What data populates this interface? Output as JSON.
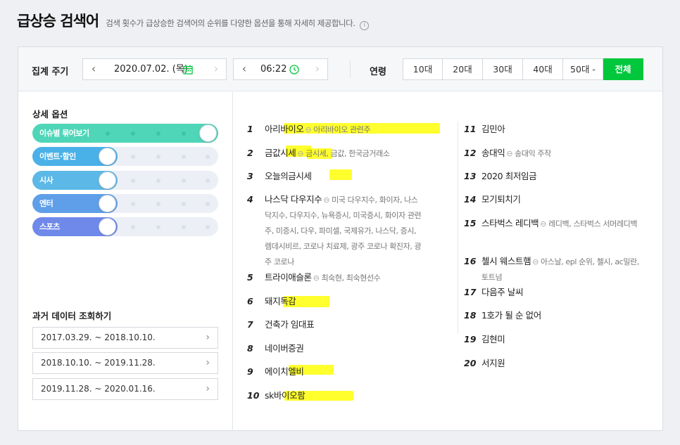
{
  "header": {
    "title": "급상승 검색어",
    "description": "검색 횟수가 급상승한 검색어의 순위를 다양한 옵션을 통해 자세히 제공합니다.",
    "info_icon": "i"
  },
  "filters": {
    "period_label": "집계 주기",
    "date": "2020.07.02. (목)",
    "time": "06:22",
    "prev_icon": "‹",
    "next_icon": "›",
    "age_label": "연령",
    "age_buttons": [
      "10대",
      "20대",
      "30대",
      "40대",
      "50대 -",
      "전체"
    ],
    "age_selected": "전체",
    "accent_color": "#00c73c"
  },
  "options": {
    "title": "상세 옵션",
    "toggles": [
      {
        "label": "이슈별 묶어보기",
        "on": true,
        "color": "#4fd6b8"
      },
      {
        "label": "이벤트·할인",
        "on": false,
        "color": "#4ab1e8"
      },
      {
        "label": "시사",
        "on": false,
        "color": "#5cb8e6"
      },
      {
        "label": "엔터",
        "on": false,
        "color": "#5f9ee8"
      },
      {
        "label": "스포츠",
        "on": false,
        "color": "#6f89ea"
      }
    ]
  },
  "history": {
    "title": "과거 데이터 조회하기",
    "periods": [
      "2017.03.29. ~ 2018.10.10.",
      "2018.10.10. ~ 2019.11.28.",
      "2019.11.28. ~ 2020.01.16."
    ],
    "chevron": "›"
  },
  "rankings": [
    {
      "rank": "1",
      "keyword": "아리바이오",
      "related": "아리바이오 관련주"
    },
    {
      "rank": "2",
      "keyword": "금값시세",
      "related": "금시세, 금값, 한국금거래소"
    },
    {
      "rank": "3",
      "keyword": "오늘의금시세",
      "related": ""
    },
    {
      "rank": "4",
      "keyword": "나스닥 다우지수",
      "related": "미국 다우지수, 화이자, 나스닥지수, 다우지수, 뉴욕증시, 미국증시, 화이자 관련주, 미증시, 다우, 파미셀, 국제유가, 나스닥, 증시, 렘데시비르, 코로나 치료제, 광주 코로나 확진자, 광주 코로나"
    },
    {
      "rank": "5",
      "keyword": "트라이애슬론",
      "related": "최숙현, 최숙현선수"
    },
    {
      "rank": "6",
      "keyword": "돼지독감",
      "related": ""
    },
    {
      "rank": "7",
      "keyword": "건축가 임대표",
      "related": ""
    },
    {
      "rank": "8",
      "keyword": "네이버증권",
      "related": ""
    },
    {
      "rank": "9",
      "keyword": "에이치엘비",
      "related": ""
    },
    {
      "rank": "10",
      "keyword": "sk바이오팜",
      "related": ""
    },
    {
      "rank": "11",
      "keyword": "김민아",
      "related": ""
    },
    {
      "rank": "12",
      "keyword": "송대익",
      "related": "송대익 주작"
    },
    {
      "rank": "13",
      "keyword": "2020 최저임금",
      "related": ""
    },
    {
      "rank": "14",
      "keyword": "모기퇴치기",
      "related": ""
    },
    {
      "rank": "15",
      "keyword": "스타벅스 레디백",
      "related": "레디백, 스타벅스 서머레디백"
    },
    {
      "rank": "16",
      "keyword": "첼시 웨스트햄",
      "related": "아스날, epl 순위, 첼시, ac밀란, 토트넘"
    },
    {
      "rank": "17",
      "keyword": "다음주 날씨",
      "related": ""
    },
    {
      "rank": "18",
      "keyword": "1호가 될 순 없어",
      "related": ""
    },
    {
      "rank": "19",
      "keyword": "김현미",
      "related": ""
    },
    {
      "rank": "20",
      "keyword": "서지원",
      "related": ""
    }
  ]
}
